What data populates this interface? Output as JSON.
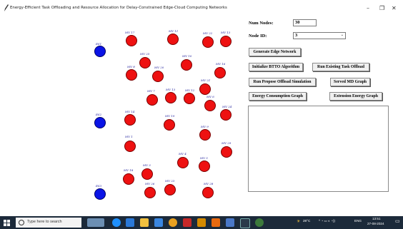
{
  "window": {
    "title": "Energy-Efficient Task Offloading and Resource Allocation for Delay-Constrained Edge-Cloud Computing Networks",
    "minimize": "–",
    "maximize": "❐",
    "close": "✕"
  },
  "controls": {
    "num_nodes_label": "Num Nodes:",
    "num_nodes_value": "30",
    "node_id_label": "Node ID:",
    "node_id_value": "3",
    "buttons": {
      "generate": "Generate Edge Network",
      "init_btto": "Initialize BTTO Algorithm",
      "run_existing": "Run Existing Task Offload",
      "run_propose": "Run Propose Offload Simulation",
      "served_md": "Served MD Graph",
      "energy": "Energy Consumption Graph",
      "extension": "Extension Energy Graph"
    }
  },
  "network": {
    "edge_servers": [
      {
        "label": "ES1"
      },
      {
        "label": "ES2"
      },
      {
        "label": "ES3"
      }
    ],
    "mobile_devices": [
      {
        "label": "MV 17"
      },
      {
        "label": "MV 11"
      },
      {
        "label": "MV 22"
      },
      {
        "label": "MV 13"
      },
      {
        "label": "MV 25"
      },
      {
        "label": "MV 10"
      },
      {
        "label": "MV 8"
      },
      {
        "label": "MV 20"
      },
      {
        "label": "MV 16"
      },
      {
        "label": "MV 21"
      },
      {
        "label": "MV 7"
      },
      {
        "label": "MV 13"
      },
      {
        "label": "MV 12"
      },
      {
        "label": "MV 6"
      },
      {
        "label": "MV 24"
      },
      {
        "label": "MV 14"
      },
      {
        "label": "MV 19"
      },
      {
        "label": "MV 9"
      },
      {
        "label": "MV 1"
      },
      {
        "label": "MV 29"
      },
      {
        "label": "MV 4"
      },
      {
        "label": "MV 5"
      },
      {
        "label": "MV 3"
      },
      {
        "label": "MV 18"
      },
      {
        "label": "MV 26"
      },
      {
        "label": "MV 23"
      },
      {
        "label": "MV 28"
      }
    ]
  },
  "taskbar": {
    "search_placeholder": "Type here to search",
    "weather": "28°C",
    "language": "ENG",
    "time": "13:51",
    "date": "27-08-2024"
  },
  "colors": {
    "mobile_device": "#ee1111",
    "edge_server": "#0a14e6",
    "label_text": "#1a1a9a",
    "taskbar": "#1c2a3a"
  }
}
